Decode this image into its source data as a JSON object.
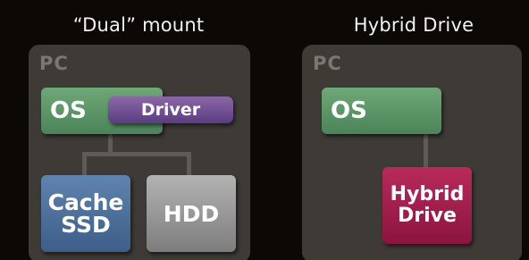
{
  "left": {
    "title": "“Dual” mount",
    "pc_label": "PC",
    "os_label": "OS",
    "driver_label": "Driver",
    "cache_line1": "Cache",
    "cache_line2": "SSD",
    "hdd_label": "HDD"
  },
  "right": {
    "title": "Hybrid Drive",
    "pc_label": "PC",
    "os_label": "OS",
    "hybrid_line1": "Hybrid",
    "hybrid_line2": "Drive"
  },
  "colors": {
    "background": "#0b0806",
    "panel": "#3e3b37",
    "os": "#5a9468",
    "driver": "#6e4d94",
    "cache_ssd": "#4c6f98",
    "hdd": "#999999",
    "hybrid_drive": "#a31d4e",
    "connector": "#5e5a55"
  }
}
